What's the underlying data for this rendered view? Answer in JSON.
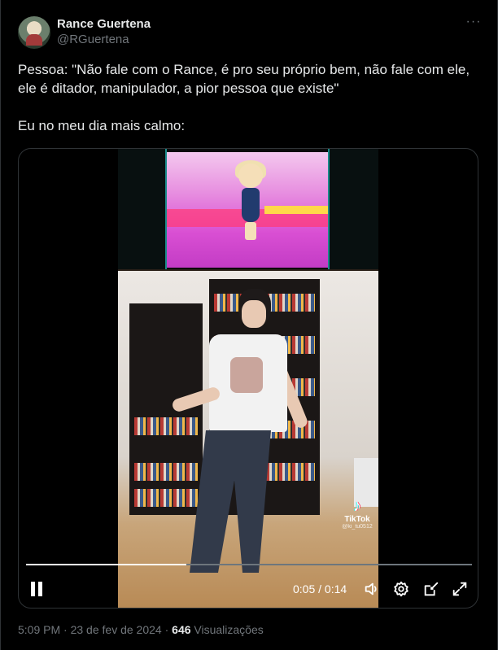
{
  "author": {
    "display_name": "Rance Guertena",
    "handle": "@RGuertena"
  },
  "tweet": {
    "text": "Pessoa: \"Não fale com o Rance, é pro seu próprio bem, não fale com ele, ele é ditador, manipulador, a pior pessoa que existe\"\n\nEu no meu dia mais calmo:"
  },
  "video": {
    "progress_fraction": 0.36,
    "time_display": "0:05 / 0:14",
    "watermark_brand": "TikTok",
    "watermark_user": "@ki_tu0512",
    "controls": {
      "pause_icon": "pause-icon",
      "volume_icon": "volume-icon",
      "settings_icon": "gear-icon",
      "dock_icon": "dock-icon",
      "fullscreen_icon": "fullscreen-icon"
    }
  },
  "meta": {
    "time": "5:09 PM",
    "separator": "·",
    "date": "23 de fev de 2024",
    "views_count": "646",
    "views_label": "Visualizações"
  },
  "colors": {
    "background": "#000000",
    "text_primary": "#e7e9ea",
    "text_secondary": "#71767b",
    "border": "#2f3336"
  }
}
